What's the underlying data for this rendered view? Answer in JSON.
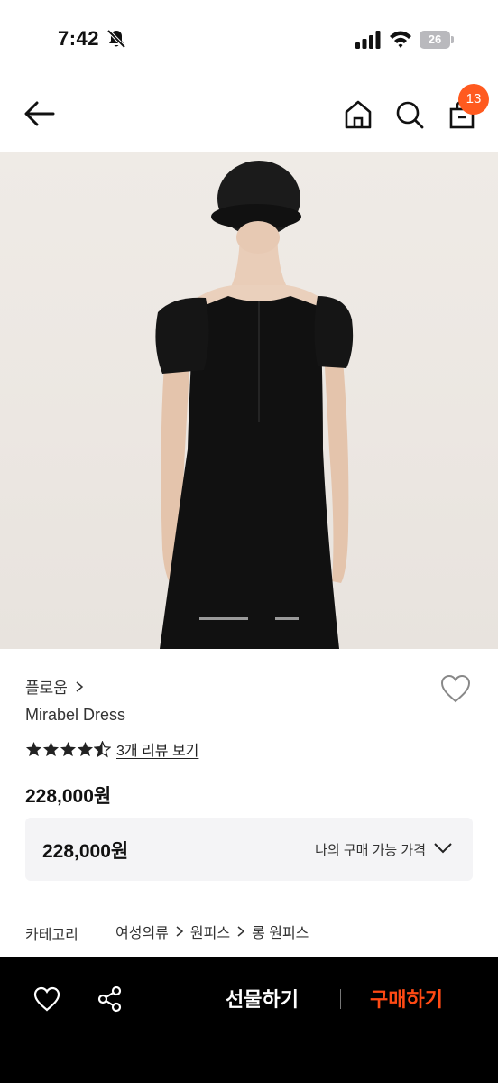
{
  "status_bar": {
    "time": "7:42",
    "battery": "26",
    "icons": [
      "bell-slash-icon",
      "signal-icon",
      "wifi-icon",
      "battery-icon"
    ]
  },
  "nav": {
    "icons": [
      "back-arrow-icon",
      "home-icon",
      "search-icon",
      "shopping-bag-icon"
    ],
    "cart_count": "13",
    "badge_color": "#ff5a1f"
  },
  "gallery": {
    "image": "product-photo-woman-black-dress-back-view",
    "page_count": 3,
    "active_page": 2
  },
  "product": {
    "brand": "플로움",
    "name": "Mirabel Dress",
    "rating": 4.5,
    "review_link": "3개 리뷰 보기",
    "price": "228,000원"
  },
  "price_box": {
    "value": "228,000원",
    "label": "나의 구매 가능 가격"
  },
  "category": {
    "label": "카테고리",
    "path": [
      "여성의류",
      "원피스",
      "롱 원피스"
    ]
  },
  "actions": {
    "gift": "선물하기",
    "buy": "구매하기",
    "buy_color": "#ff4a14"
  }
}
